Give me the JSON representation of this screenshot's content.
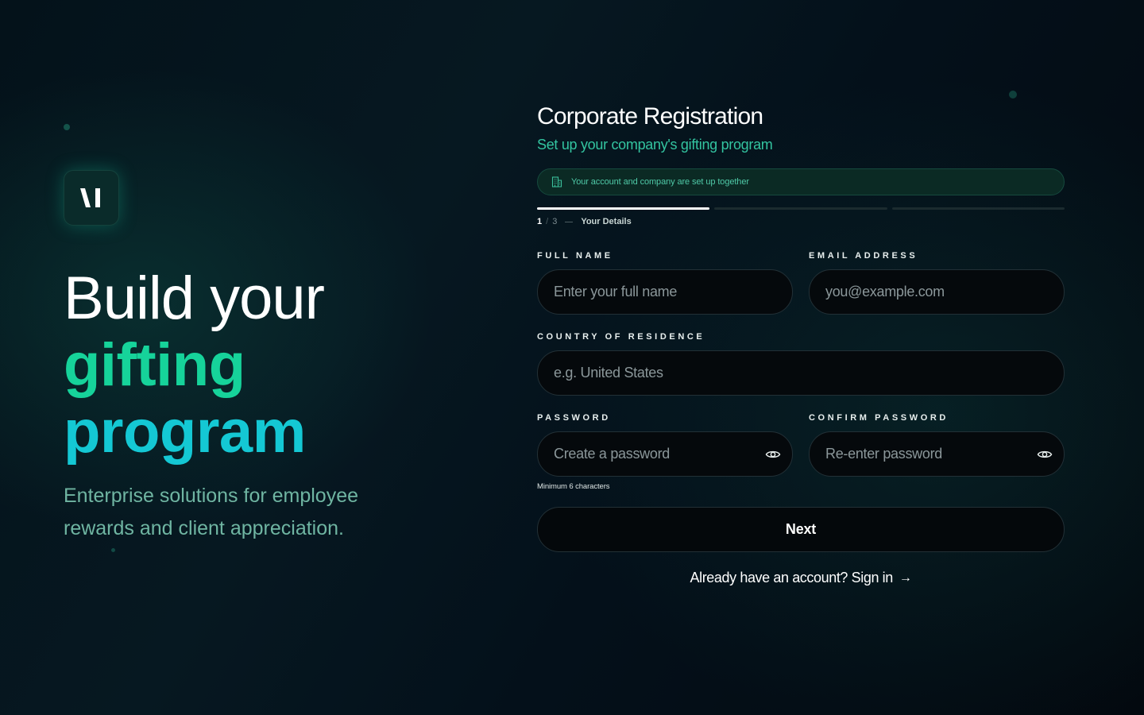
{
  "hero": {
    "line1": "Build your",
    "line2": "gifting",
    "line3": "program",
    "subtitle": "Enterprise solutions for employee rewards and client appreciation."
  },
  "form": {
    "title": "Corporate Registration",
    "subtitle": "Set up your company's gifting program",
    "banner": "Your account and company are set up together",
    "step": {
      "current": "1",
      "separator": "/",
      "total": "3",
      "label": "Your Details",
      "progress_fraction": 0.333
    },
    "fields": {
      "full_name": {
        "label": "FULL NAME",
        "placeholder": "Enter your full name"
      },
      "email": {
        "label": "EMAIL ADDRESS",
        "placeholder": "you@example.com"
      },
      "country": {
        "label": "COUNTRY OF RESIDENCE",
        "placeholder": "e.g. United States"
      },
      "password": {
        "label": "PASSWORD",
        "placeholder": "Create a password",
        "hint": "Minimum 6 characters"
      },
      "confirm_password": {
        "label": "CONFIRM PASSWORD",
        "placeholder": "Re-enter password"
      }
    },
    "next_label": "Next",
    "signin_label": "Already have an account? Sign in",
    "signin_arrow": "→"
  },
  "icons": {
    "logo": "brand-logo-icon",
    "banner": "building-icon",
    "password_toggle": "eye-icon"
  },
  "colors": {
    "accent_green": "#16d39a",
    "accent_cyan": "#14c8d4",
    "subtitle_green": "#33c4a0",
    "banner_bg": "#0b2a24"
  }
}
